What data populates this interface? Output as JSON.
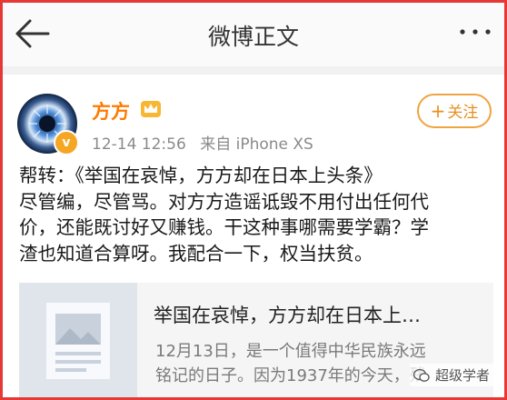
{
  "header": {
    "title": "微博正文",
    "back_icon": "back-arrow-icon",
    "more_icon": "more-dots-icon"
  },
  "author": {
    "name": "方方",
    "timestamp": "12-14 12:56",
    "source": "来自 iPhone XS",
    "follow_plus": "+",
    "follow_label": "关注"
  },
  "post": {
    "lines": [
      "帮转：《举国在哀悼，方方却在日本上头条》",
      "尽管编，尽管骂。对方方造谣诋毁不用付出任何代",
      "价，还能既讨好又赚钱。干这种事哪需要学霸？学",
      "渣也知道合算呀。我配合一下，权当扶贫。"
    ]
  },
  "card": {
    "title": "举国在哀悼，方方却在日本上…",
    "desc_line1": "12月13日，是一个值得中华民族永远",
    "desc_line2": "铭记的日子。因为1937年的今天，残"
  },
  "watermark": {
    "text": "超级学者"
  },
  "colors": {
    "accent_orange": "#ff7a00",
    "frame_red": "#e53935",
    "follow_border": "#f0a341"
  }
}
